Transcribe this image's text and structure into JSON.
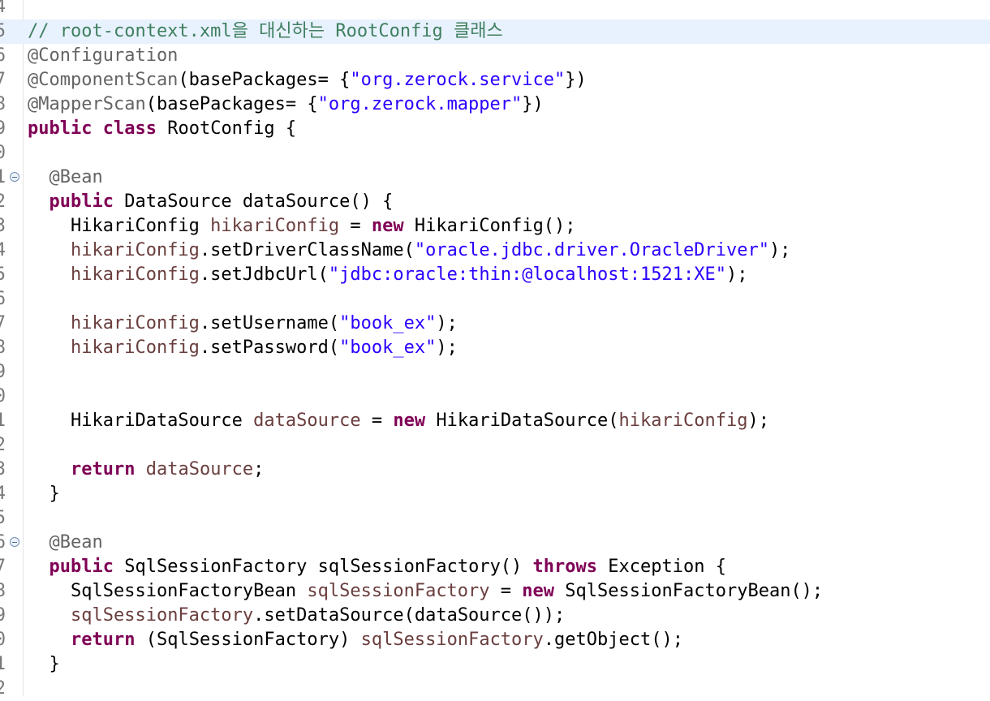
{
  "editor": {
    "colors": {
      "keyword": "#7f0055",
      "string": "#2a00ff",
      "local_variable": "#6a3e3e",
      "annotation": "#646464",
      "comment": "#3f7f5f",
      "current_line": "#e8f2fe",
      "line_number": "#787878"
    },
    "lines": [
      {
        "num": "4",
        "tokens": []
      },
      {
        "num": "5",
        "current": true,
        "tokens": [
          {
            "t": "cmt",
            "v": "// root-context.xml을 대신하는 RootConfig 클래스"
          }
        ]
      },
      {
        "num": "6",
        "tokens": [
          {
            "t": "ann",
            "v": "@Configuration"
          }
        ]
      },
      {
        "num": "7",
        "tokens": [
          {
            "t": "ann",
            "v": "@ComponentScan"
          },
          {
            "t": "txt",
            "v": "(basePackages= {"
          },
          {
            "t": "str",
            "v": "\"org.zerock.service\""
          },
          {
            "t": "txt",
            "v": "})"
          }
        ]
      },
      {
        "num": "8",
        "tokens": [
          {
            "t": "ann",
            "v": "@MapperScan"
          },
          {
            "t": "txt",
            "v": "(basePackages= {"
          },
          {
            "t": "str",
            "v": "\"org.zerock.mapper\""
          },
          {
            "t": "txt",
            "v": "})"
          }
        ]
      },
      {
        "num": "9",
        "tokens": [
          {
            "t": "kw",
            "v": "public"
          },
          {
            "t": "txt",
            "v": " "
          },
          {
            "t": "kw",
            "v": "class"
          },
          {
            "t": "txt",
            "v": " RootConfig {"
          }
        ]
      },
      {
        "num": "0",
        "tokens": []
      },
      {
        "num": "1",
        "fold": true,
        "tokens": [
          {
            "t": "ann",
            "v": "  @Bean"
          }
        ]
      },
      {
        "num": "2",
        "tokens": [
          {
            "t": "txt",
            "v": "  "
          },
          {
            "t": "kw",
            "v": "public"
          },
          {
            "t": "txt",
            "v": " DataSource dataSource() {"
          }
        ]
      },
      {
        "num": "3",
        "tokens": [
          {
            "t": "txt",
            "v": "    HikariConfig "
          },
          {
            "t": "var",
            "v": "hikariConfig"
          },
          {
            "t": "txt",
            "v": " = "
          },
          {
            "t": "kw",
            "v": "new"
          },
          {
            "t": "txt",
            "v": " HikariConfig();"
          }
        ]
      },
      {
        "num": "4",
        "tokens": [
          {
            "t": "txt",
            "v": "    "
          },
          {
            "t": "var",
            "v": "hikariConfig"
          },
          {
            "t": "txt",
            "v": ".setDriverClassName("
          },
          {
            "t": "str",
            "v": "\"oracle.jdbc.driver.OracleDriver\""
          },
          {
            "t": "txt",
            "v": ");"
          }
        ]
      },
      {
        "num": "5",
        "tokens": [
          {
            "t": "txt",
            "v": "    "
          },
          {
            "t": "var",
            "v": "hikariConfig"
          },
          {
            "t": "txt",
            "v": ".setJdbcUrl("
          },
          {
            "t": "str",
            "v": "\"jdbc:oracle:thin:@localhost:1521:XE\""
          },
          {
            "t": "txt",
            "v": ");"
          }
        ]
      },
      {
        "num": "6",
        "tokens": []
      },
      {
        "num": "7",
        "tokens": [
          {
            "t": "txt",
            "v": "    "
          },
          {
            "t": "var",
            "v": "hikariConfig"
          },
          {
            "t": "txt",
            "v": ".setUsername("
          },
          {
            "t": "str",
            "v": "\"book_ex\""
          },
          {
            "t": "txt",
            "v": ");"
          }
        ]
      },
      {
        "num": "8",
        "tokens": [
          {
            "t": "txt",
            "v": "    "
          },
          {
            "t": "var",
            "v": "hikariConfig"
          },
          {
            "t": "txt",
            "v": ".setPassword("
          },
          {
            "t": "str",
            "v": "\"book_ex\""
          },
          {
            "t": "txt",
            "v": ");"
          }
        ]
      },
      {
        "num": "9",
        "tokens": []
      },
      {
        "num": "0",
        "tokens": []
      },
      {
        "num": "1",
        "tokens": [
          {
            "t": "txt",
            "v": "    HikariDataSource "
          },
          {
            "t": "var",
            "v": "dataSource"
          },
          {
            "t": "txt",
            "v": " = "
          },
          {
            "t": "kw",
            "v": "new"
          },
          {
            "t": "txt",
            "v": " HikariDataSource("
          },
          {
            "t": "var",
            "v": "hikariConfig"
          },
          {
            "t": "txt",
            "v": ");"
          }
        ]
      },
      {
        "num": "2",
        "tokens": []
      },
      {
        "num": "3",
        "tokens": [
          {
            "t": "txt",
            "v": "    "
          },
          {
            "t": "kw",
            "v": "return"
          },
          {
            "t": "txt",
            "v": " "
          },
          {
            "t": "var",
            "v": "dataSource"
          },
          {
            "t": "txt",
            "v": ";"
          }
        ]
      },
      {
        "num": "4",
        "tokens": [
          {
            "t": "txt",
            "v": "  }"
          }
        ]
      },
      {
        "num": "5",
        "tokens": []
      },
      {
        "num": "6",
        "fold": true,
        "tokens": [
          {
            "t": "ann",
            "v": "  @Bean"
          }
        ]
      },
      {
        "num": "7",
        "tokens": [
          {
            "t": "txt",
            "v": "  "
          },
          {
            "t": "kw",
            "v": "public"
          },
          {
            "t": "txt",
            "v": " SqlSessionFactory sqlSessionFactory() "
          },
          {
            "t": "kw",
            "v": "throws"
          },
          {
            "t": "txt",
            "v": " Exception {"
          }
        ]
      },
      {
        "num": "8",
        "tokens": [
          {
            "t": "txt",
            "v": "    SqlSessionFactoryBean "
          },
          {
            "t": "var",
            "v": "sqlSessionFactory"
          },
          {
            "t": "txt",
            "v": " = "
          },
          {
            "t": "kw",
            "v": "new"
          },
          {
            "t": "txt",
            "v": " SqlSessionFactoryBean();"
          }
        ]
      },
      {
        "num": "9",
        "tokens": [
          {
            "t": "txt",
            "v": "    "
          },
          {
            "t": "var",
            "v": "sqlSessionFactory"
          },
          {
            "t": "txt",
            "v": ".setDataSource(dataSource());"
          }
        ]
      },
      {
        "num": "0",
        "tokens": [
          {
            "t": "txt",
            "v": "    "
          },
          {
            "t": "kw",
            "v": "return"
          },
          {
            "t": "txt",
            "v": " (SqlSessionFactory) "
          },
          {
            "t": "var",
            "v": "sqlSessionFactory"
          },
          {
            "t": "txt",
            "v": ".getObject();"
          }
        ]
      },
      {
        "num": "1",
        "tokens": [
          {
            "t": "txt",
            "v": "  }"
          }
        ]
      },
      {
        "num": "2",
        "tokens": []
      }
    ]
  }
}
